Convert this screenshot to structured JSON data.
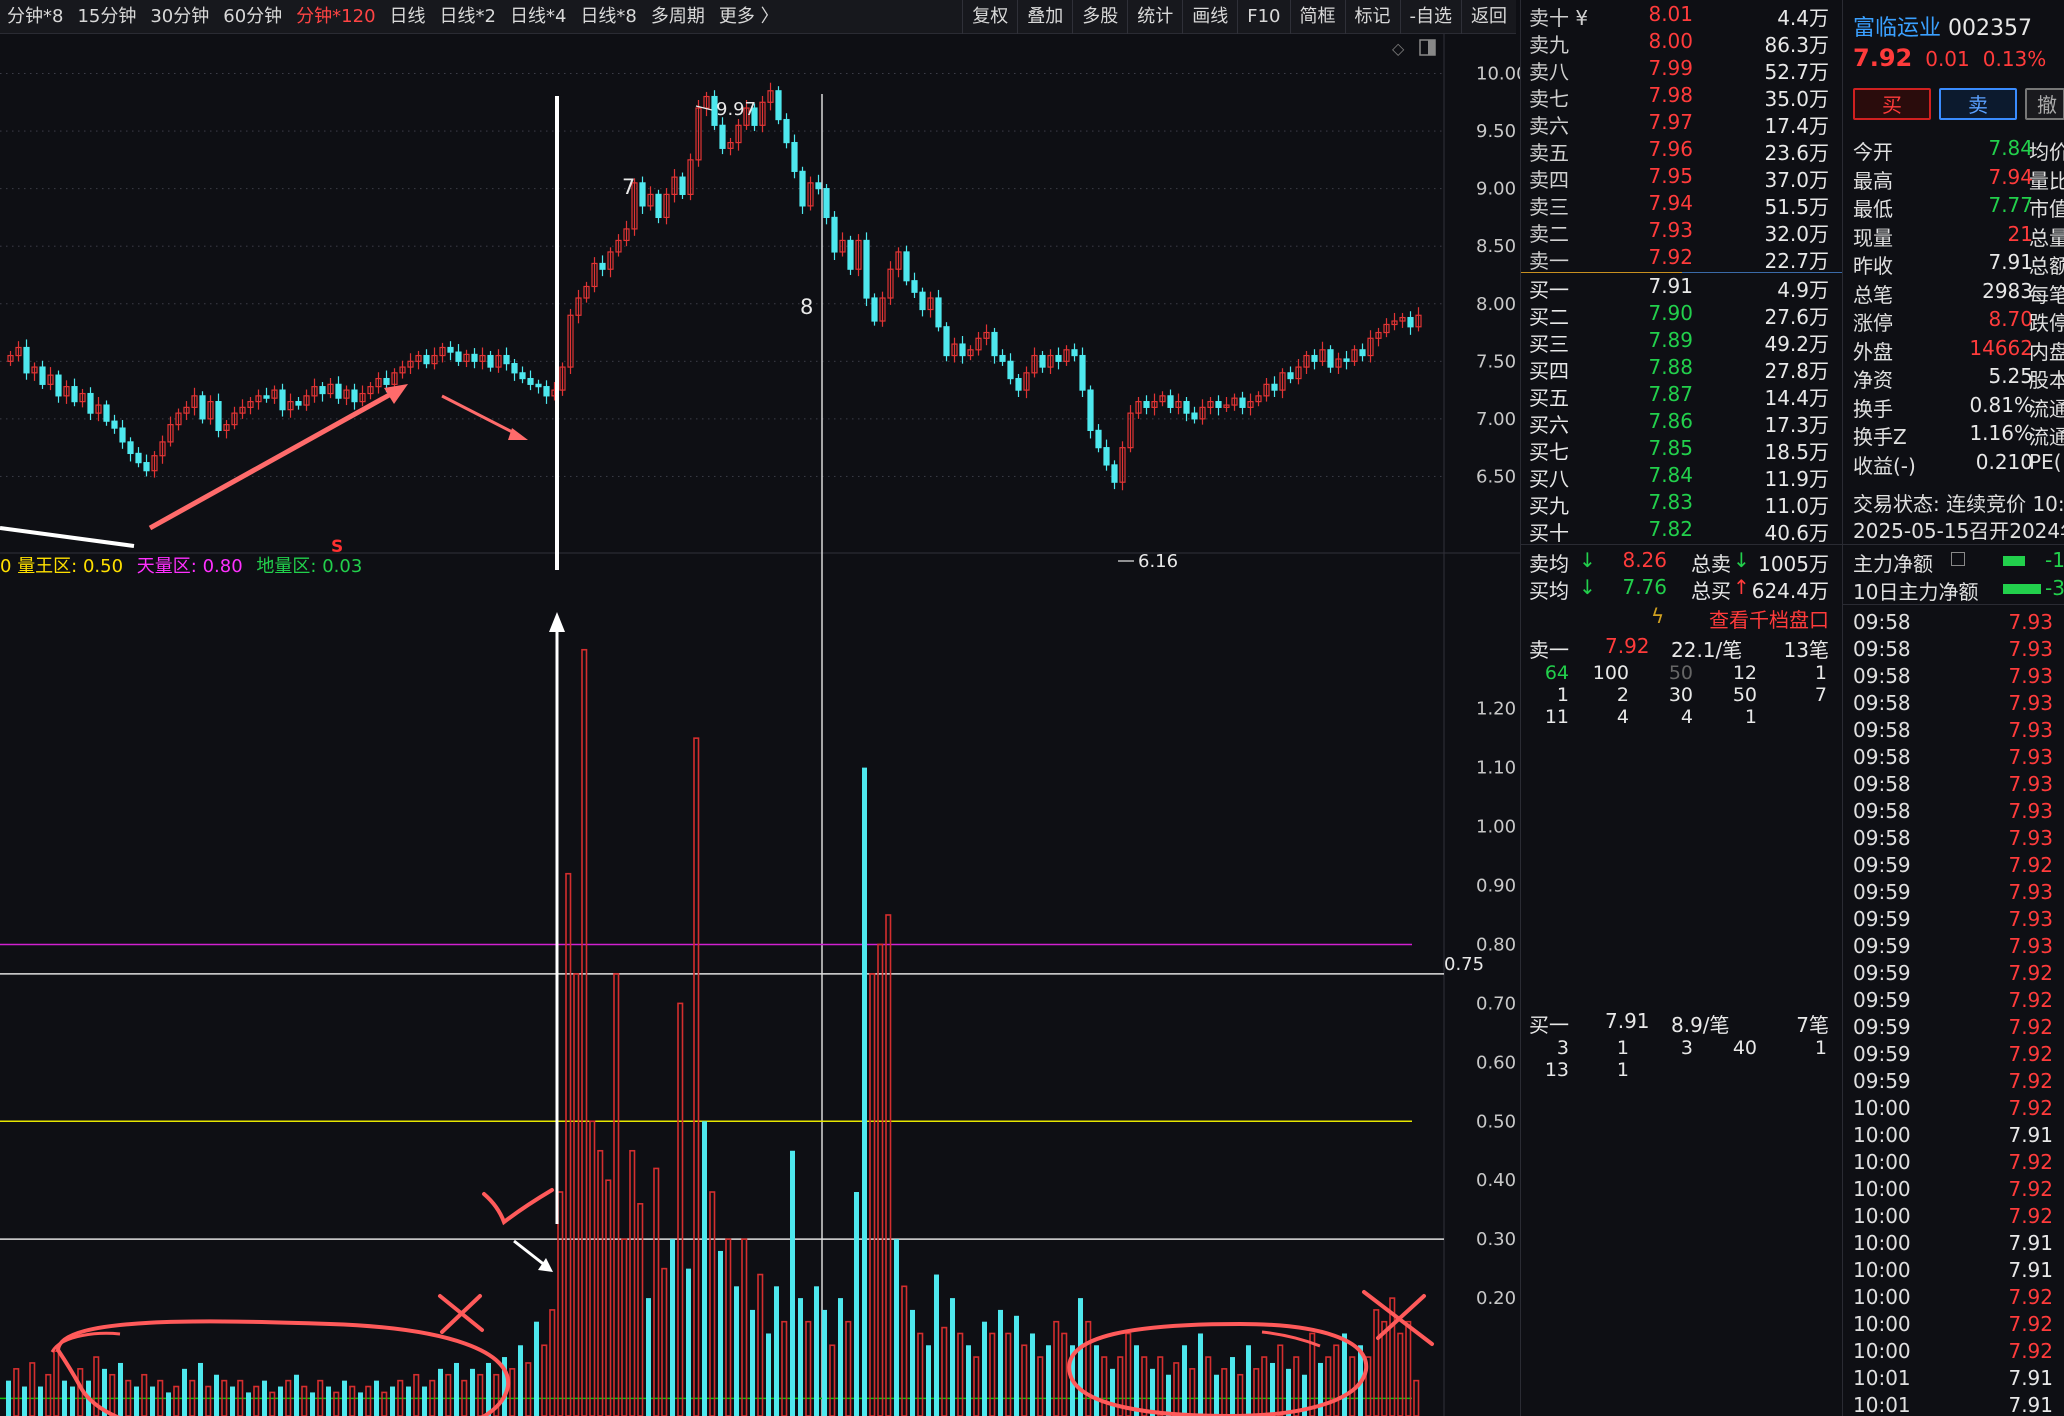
{
  "toolbar": {
    "periods": [
      "分钟*8",
      "15分钟",
      "30分钟",
      "60分钟",
      "分钟*120",
      "日线",
      "日线*2",
      "日线*4",
      "日线*8",
      "多周期",
      "更多 〉"
    ],
    "active_period": "分钟*120",
    "actions": [
      "复权",
      "叠加",
      "多股",
      "统计",
      "画线",
      "F10",
      "简框",
      "标记",
      "-自选",
      "返回"
    ]
  },
  "price_chart": {
    "y_ticks": [
      "10.00",
      "9.50",
      "9.00",
      "8.50",
      "8.00",
      "7.50",
      "7.00",
      "6.50"
    ],
    "high_label": "9.97",
    "low_label": "6.16",
    "wave_labels": [
      "7",
      "8"
    ],
    "signal_mark": "S"
  },
  "volume_chart": {
    "legend_prefix": "0",
    "legend_kingzone": "量王区: 0.50",
    "legend_skyzone": "天量区: 0.80",
    "legend_groundzone": "地量区: 0.03",
    "y_ticks": [
      "1.20",
      "1.10",
      "1.00",
      "0.90",
      "0.80",
      "0.70",
      "0.60",
      "0.50",
      "0.40",
      "0.30",
      "0.20"
    ],
    "marker_075": "0.75",
    "colors": {
      "up": "#d42e2e",
      "down": "#4ee8ee",
      "king": "#e6e600",
      "sky": "#d020d0",
      "ground": "#10c010"
    }
  },
  "order_book": {
    "asks": [
      {
        "label": "卖十 ¥",
        "price": "8.01",
        "vol": "4.4万"
      },
      {
        "label": "卖九",
        "price": "8.00",
        "vol": "86.3万"
      },
      {
        "label": "卖八",
        "price": "7.99",
        "vol": "52.7万"
      },
      {
        "label": "卖七",
        "price": "7.98",
        "vol": "35.0万"
      },
      {
        "label": "卖六",
        "price": "7.97",
        "vol": "17.4万"
      },
      {
        "label": "卖五",
        "price": "7.96",
        "vol": "23.6万"
      },
      {
        "label": "卖四",
        "price": "7.95",
        "vol": "37.0万"
      },
      {
        "label": "卖三",
        "price": "7.94",
        "vol": "51.5万"
      },
      {
        "label": "卖二",
        "price": "7.93",
        "vol": "32.0万"
      },
      {
        "label": "卖一",
        "price": "7.92",
        "vol": "22.7万"
      }
    ],
    "bids": [
      {
        "label": "买一",
        "price": "7.91",
        "vol": "4.9万"
      },
      {
        "label": "买二",
        "price": "7.90",
        "vol": "27.6万"
      },
      {
        "label": "买三",
        "price": "7.89",
        "vol": "49.2万"
      },
      {
        "label": "买四",
        "price": "7.88",
        "vol": "27.8万"
      },
      {
        "label": "买五",
        "price": "7.87",
        "vol": "14.4万"
      },
      {
        "label": "买六",
        "price": "7.86",
        "vol": "17.3万"
      },
      {
        "label": "买七",
        "price": "7.85",
        "vol": "18.5万"
      },
      {
        "label": "买八",
        "price": "7.84",
        "vol": "11.9万"
      },
      {
        "label": "买九",
        "price": "7.83",
        "vol": "11.0万"
      },
      {
        "label": "买十",
        "price": "7.82",
        "vol": "40.6万"
      }
    ],
    "avg_sell_label": "卖均",
    "avg_sell": "8.26",
    "total_sell_label": "总卖",
    "total_sell": "1005万",
    "avg_buy_label": "买均",
    "avg_buy": "7.76",
    "total_buy_label": "总买",
    "total_buy": "624.4万",
    "view_thousand": "查看千档盘口",
    "ask1_detail": {
      "label": "卖一",
      "price": "7.92",
      "per": "22.1/笔",
      "count": "13笔"
    },
    "ask1_queue": [
      [
        "64",
        "100",
        "50",
        "12",
        "1"
      ],
      [
        "1",
        "2",
        "30",
        "50",
        "7"
      ],
      [
        "11",
        "4",
        "4",
        "1",
        ""
      ]
    ],
    "bid1_detail": {
      "label": "买一",
      "price": "7.91",
      "per": "8.9/笔",
      "count": "7笔"
    },
    "bid1_queue": [
      [
        "3",
        "1",
        "3",
        "40",
        "1"
      ],
      [
        "13",
        "1",
        "",
        "",
        ""
      ]
    ]
  },
  "stock": {
    "name": "富临运业",
    "code": "002357",
    "price": "7.92",
    "change": "0.01",
    "pct": "0.13%",
    "buy_label": "买",
    "sell_label": "卖",
    "cancel_label": "撤"
  },
  "stats": [
    {
      "k": "今开",
      "v": "7.84",
      "c": "green",
      "k2": "均价"
    },
    {
      "k": "最高",
      "v": "7.94",
      "c": "red",
      "k2": "量比"
    },
    {
      "k": "最低",
      "v": "7.77",
      "c": "green",
      "k2": "市值"
    },
    {
      "k": "现量",
      "v": "21",
      "c": "red",
      "k2": "总量"
    },
    {
      "k": "昨收",
      "v": "7.91",
      "c": "white",
      "k2": "总额"
    },
    {
      "k": "总笔",
      "v": "2983",
      "c": "white",
      "k2": "每笔"
    },
    {
      "k": "涨停",
      "v": "8.70",
      "c": "red",
      "k2": "跌停"
    },
    {
      "k": "外盘",
      "v": "14662",
      "c": "red",
      "k2": "内盘"
    },
    {
      "k": "净资",
      "v": "5.25",
      "c": "white",
      "k2": "股本"
    },
    {
      "k": "换手",
      "v": "0.81%",
      "c": "white",
      "k2": "流通"
    },
    {
      "k": "换手Z",
      "v": "1.16%",
      "c": "white",
      "k2": "流通"
    },
    {
      "k": "收益(-)",
      "v": "0.210",
      "c": "white",
      "k2": "PE("
    }
  ],
  "trade_status": "交易状态: 连续竞价 10:",
  "meeting_note": "2025-05-15召开2024年",
  "main_net_label": "主力净额",
  "main_net_value": "-1",
  "main_net10_label": "10日主力净额",
  "main_net10_value": "-3",
  "ticks": [
    {
      "t": "09:58",
      "p": "7.93",
      "c": "red"
    },
    {
      "t": "09:58",
      "p": "7.93",
      "c": "red"
    },
    {
      "t": "09:58",
      "p": "7.93",
      "c": "red"
    },
    {
      "t": "09:58",
      "p": "7.93",
      "c": "red"
    },
    {
      "t": "09:58",
      "p": "7.93",
      "c": "red"
    },
    {
      "t": "09:58",
      "p": "7.93",
      "c": "red"
    },
    {
      "t": "09:58",
      "p": "7.93",
      "c": "red"
    },
    {
      "t": "09:58",
      "p": "7.93",
      "c": "red"
    },
    {
      "t": "09:58",
      "p": "7.93",
      "c": "red"
    },
    {
      "t": "09:59",
      "p": "7.92",
      "c": "red"
    },
    {
      "t": "09:59",
      "p": "7.93",
      "c": "red"
    },
    {
      "t": "09:59",
      "p": "7.93",
      "c": "red"
    },
    {
      "t": "09:59",
      "p": "7.93",
      "c": "red"
    },
    {
      "t": "09:59",
      "p": "7.92",
      "c": "red"
    },
    {
      "t": "09:59",
      "p": "7.92",
      "c": "red"
    },
    {
      "t": "09:59",
      "p": "7.92",
      "c": "red"
    },
    {
      "t": "09:59",
      "p": "7.92",
      "c": "red"
    },
    {
      "t": "09:59",
      "p": "7.92",
      "c": "red"
    },
    {
      "t": "10:00",
      "p": "7.92",
      "c": "red"
    },
    {
      "t": "10:00",
      "p": "7.91",
      "c": "white"
    },
    {
      "t": "10:00",
      "p": "7.92",
      "c": "red"
    },
    {
      "t": "10:00",
      "p": "7.92",
      "c": "red"
    },
    {
      "t": "10:00",
      "p": "7.92",
      "c": "red"
    },
    {
      "t": "10:00",
      "p": "7.91",
      "c": "white"
    },
    {
      "t": "10:00",
      "p": "7.91",
      "c": "white"
    },
    {
      "t": "10:00",
      "p": "7.92",
      "c": "red"
    },
    {
      "t": "10:00",
      "p": "7.92",
      "c": "red"
    },
    {
      "t": "10:00",
      "p": "7.92",
      "c": "red"
    },
    {
      "t": "10:01",
      "p": "7.91",
      "c": "white"
    },
    {
      "t": "10:01",
      "p": "7.91",
      "c": "white"
    }
  ]
}
